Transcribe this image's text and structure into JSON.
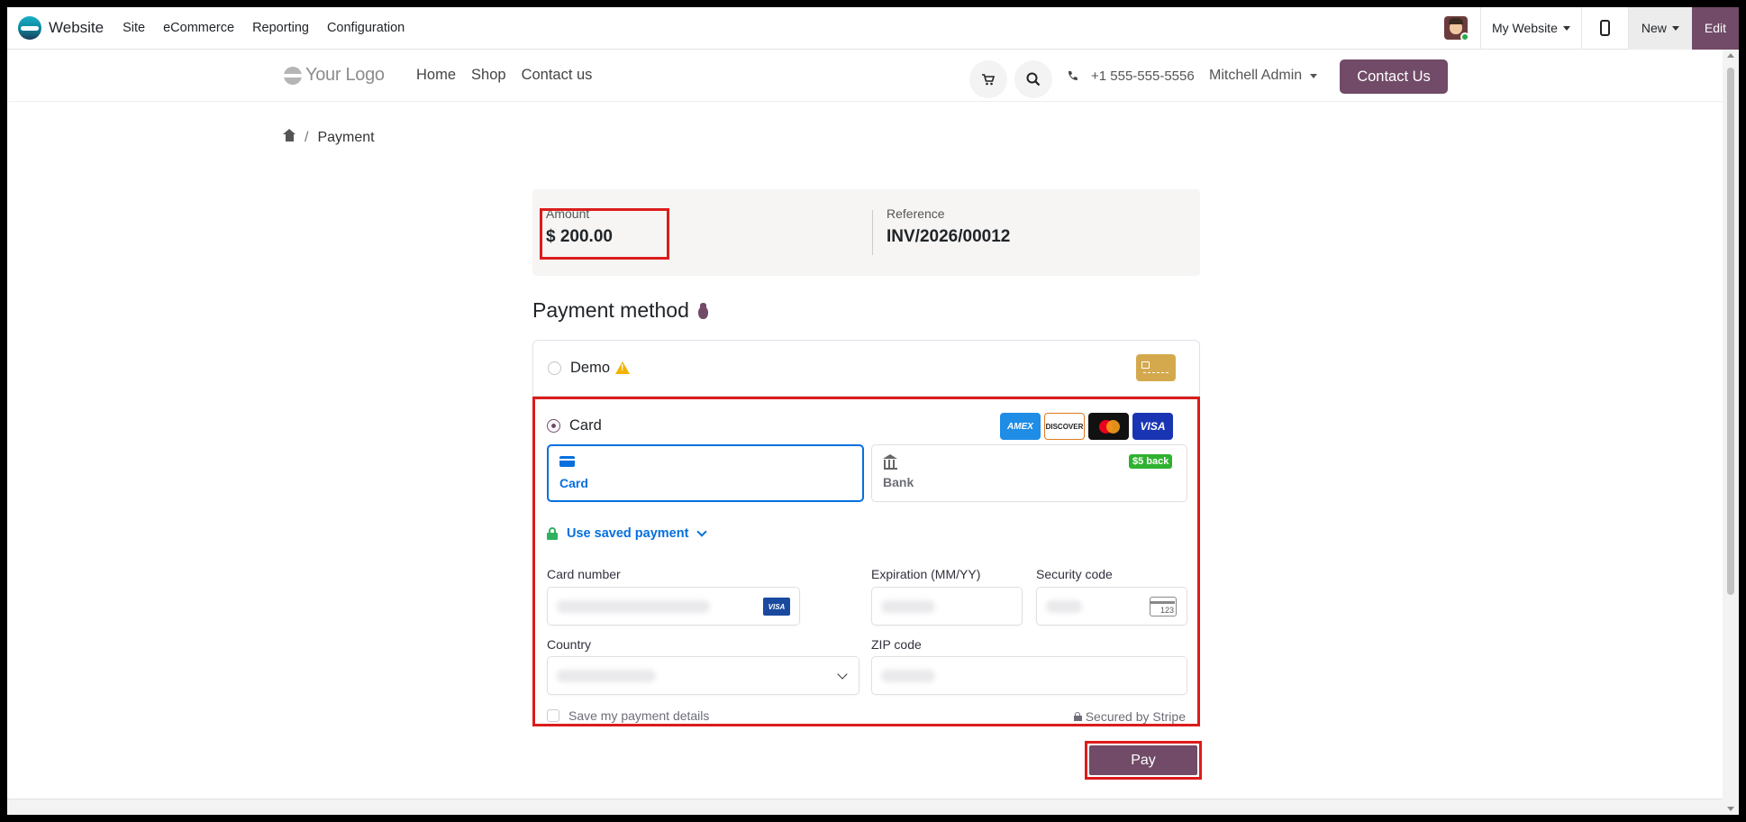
{
  "topbar": {
    "app_name": "Website",
    "menu": [
      "Site",
      "eCommerce",
      "Reporting",
      "Configuration"
    ],
    "my_website": "My Website",
    "new_label": "New",
    "edit_label": "Edit"
  },
  "header": {
    "logo_text": "Your Logo",
    "nav": [
      "Home",
      "Shop",
      "Contact us"
    ],
    "phone": "+1 555-555-5556",
    "user": "Mitchell Admin",
    "contact_button": "Contact Us"
  },
  "breadcrumb": {
    "current": "Payment",
    "separator": "/"
  },
  "summary": {
    "amount_label": "Amount",
    "amount_value": "$ 200.00",
    "reference_label": "Reference",
    "reference_value": "INV/2026/00012"
  },
  "payment": {
    "title": "Payment method",
    "demo_label": "Demo",
    "card_label": "Card",
    "brands": [
      "AMEX",
      "DISCOVER",
      "Mastercard",
      "VISA"
    ],
    "tabs": {
      "card": "Card",
      "bank": "Bank",
      "bank_badge": "$5 back"
    },
    "use_saved": "Use saved payment",
    "fields": {
      "card_number": "Card number",
      "expiration": "Expiration (MM/YY)",
      "security_code": "Security code",
      "country": "Country",
      "zip": "ZIP code",
      "cvc_hint": "123",
      "visa_badge": "VISA"
    },
    "save_details": "Save my payment details",
    "secured_by": "Secured by Stripe",
    "pay_button": "Pay"
  },
  "colors": {
    "brand": "#714b67",
    "stripe_blue": "#0570de",
    "highlight": "#dc1c1c"
  }
}
